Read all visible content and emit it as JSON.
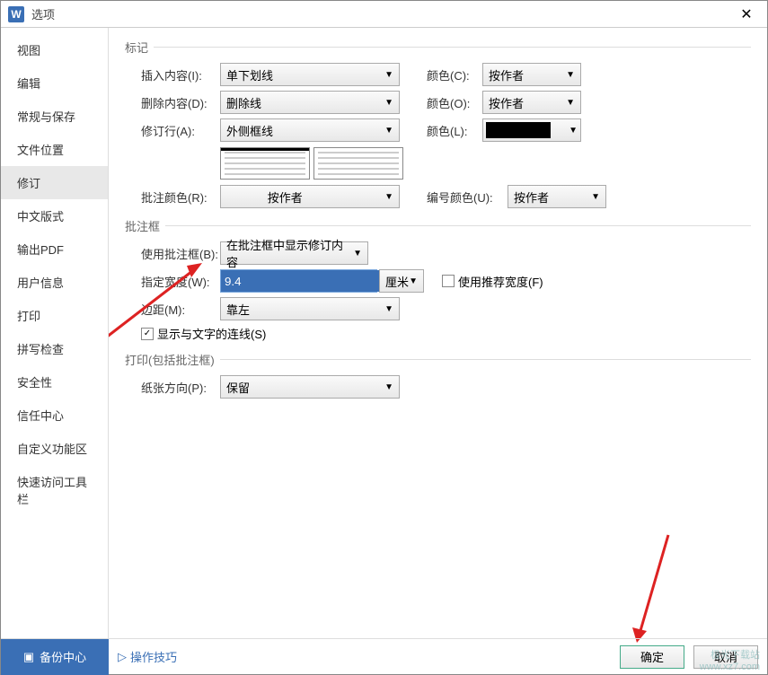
{
  "title": "选项",
  "title_icon": "W",
  "close": "✕",
  "sidebar": {
    "items": [
      {
        "label": "视图"
      },
      {
        "label": "编辑"
      },
      {
        "label": "常规与保存"
      },
      {
        "label": "文件位置"
      },
      {
        "label": "修订"
      },
      {
        "label": "中文版式"
      },
      {
        "label": "输出PDF"
      },
      {
        "label": "用户信息"
      },
      {
        "label": "打印"
      },
      {
        "label": "拼写检查"
      },
      {
        "label": "安全性"
      },
      {
        "label": "信任中心"
      },
      {
        "label": "自定义功能区"
      },
      {
        "label": "快速访问工具栏"
      }
    ],
    "active": 4
  },
  "sections": {
    "mark": {
      "title": "标记",
      "insert_label": "插入内容(I):",
      "insert_value": "单下划线",
      "color_c_label": "颜色(C):",
      "color_c_value": "按作者",
      "delete_label": "删除内容(D):",
      "delete_value": "删除线",
      "color_o_label": "颜色(O):",
      "color_o_value": "按作者",
      "revised_label": "修订行(A):",
      "revised_value": "外侧框线",
      "color_l_label": "颜色(L):",
      "comment_color_label": "批注颜色(R):",
      "comment_color_value": "按作者",
      "num_color_label": "编号颜色(U):",
      "num_color_value": "按作者"
    },
    "balloon": {
      "title": "批注框",
      "use_balloon_label": "使用批注框(B):",
      "use_balloon_value": "在批注框中显示修订内容",
      "width_label": "指定宽度(W):",
      "width_value": "9.4",
      "unit_value": "厘米",
      "use_rec_width_label": "使用推荐宽度(F)",
      "margin_label": "边距(M):",
      "margin_value": "靠左",
      "show_line_label": "显示与文字的连线(S)"
    },
    "print": {
      "title": "打印(包括批注框)",
      "paper_label": "纸张方向(P):",
      "paper_value": "保留"
    }
  },
  "footer": {
    "backup": "备份中心",
    "tips": "操作技巧",
    "ok": "确定",
    "cancel": "取消"
  },
  "watermark": {
    "l1": "极光下载站",
    "l2": "www.xz7.com"
  }
}
